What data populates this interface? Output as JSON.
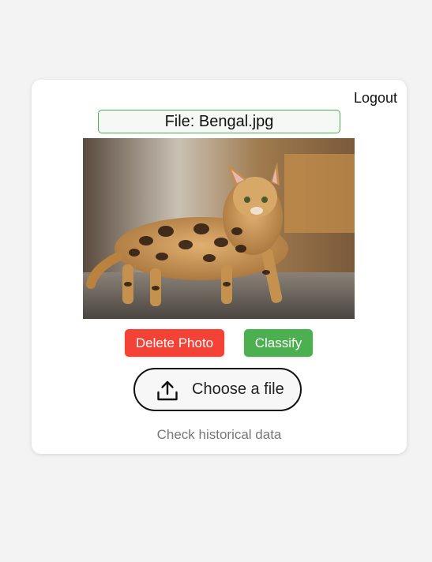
{
  "header": {
    "logout_label": "Logout"
  },
  "file": {
    "label": "File: Bengal.jpg"
  },
  "actions": {
    "delete_label": "Delete Photo",
    "classify_label": "Classify"
  },
  "upload": {
    "label": "Choose a file",
    "icon": "upload-icon"
  },
  "footer": {
    "history_label": "Check historical data"
  },
  "colors": {
    "delete": "#f44336",
    "classify": "#4caf50",
    "file_border": "#4caf50"
  }
}
